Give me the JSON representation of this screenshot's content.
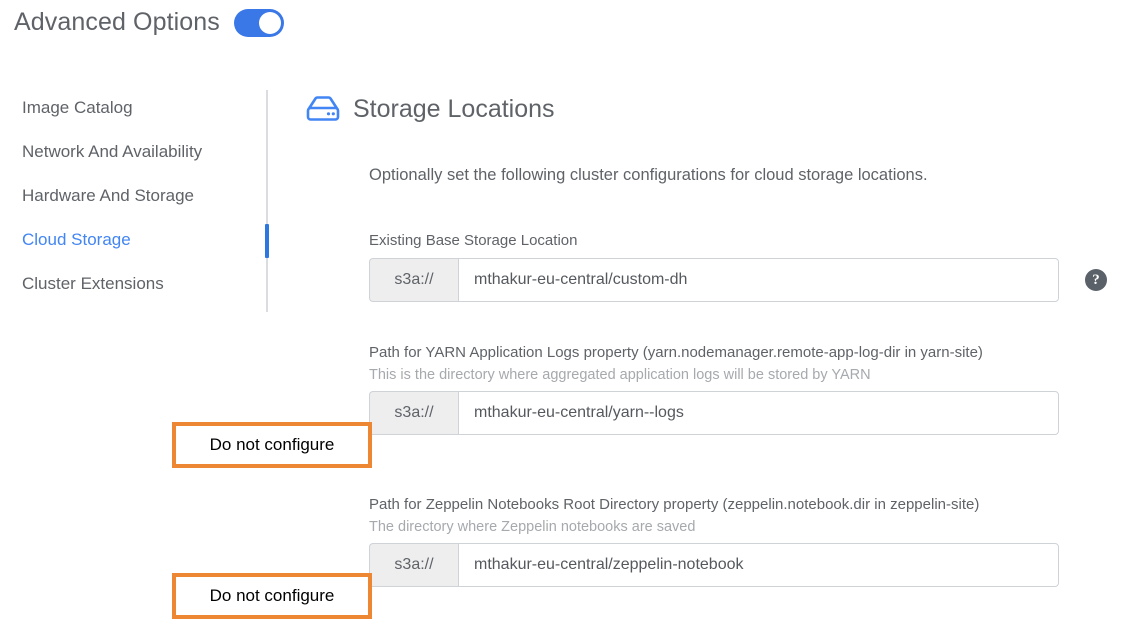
{
  "header": {
    "title": "Advanced Options",
    "toggle_state": "on",
    "toggle_color": "#3b78e7"
  },
  "sidebar": {
    "items": [
      {
        "label": "Image Catalog",
        "active": false
      },
      {
        "label": "Network And Availability",
        "active": false
      },
      {
        "label": "Hardware And Storage",
        "active": false
      },
      {
        "label": "Cloud Storage",
        "active": true
      },
      {
        "label": "Cluster Extensions",
        "active": false
      }
    ],
    "active_color": "#4285f4",
    "inactive_color": "#5f6368"
  },
  "main": {
    "icon": "storage-drive-icon",
    "icon_color": "#4285f4",
    "title": "Storage Locations",
    "intro": "Optionally set the following cluster configurations for cloud storage locations.",
    "fields": [
      {
        "label": "Existing Base Storage Location",
        "help_text": "",
        "prefix": "s3a://",
        "value": "mthakur-eu-central/custom-dh",
        "has_help_icon": true,
        "help_icon": "question-mark-circle-icon"
      },
      {
        "label": "Path for YARN Application Logs property (yarn.nodemanager.remote-app-log-dir in yarn-site)",
        "help_text": "This is the directory where aggregated application logs will be stored by YARN",
        "prefix": "s3a://",
        "value": "mthakur-eu-central/yarn--logs",
        "has_help_icon": false,
        "help_icon": ""
      },
      {
        "label": "Path for Zeppelin Notebooks Root Directory property (zeppelin.notebook.dir in zeppelin-site)",
        "help_text": "The directory where Zeppelin notebooks are saved",
        "prefix": "s3a://",
        "value": "mthakur-eu-central/zeppelin-notebook",
        "has_help_icon": false,
        "help_icon": ""
      }
    ]
  },
  "annotations": {
    "border_color": "#ed8733",
    "callouts": [
      {
        "text": "Do not configure"
      },
      {
        "text": "Do not configure"
      }
    ]
  }
}
